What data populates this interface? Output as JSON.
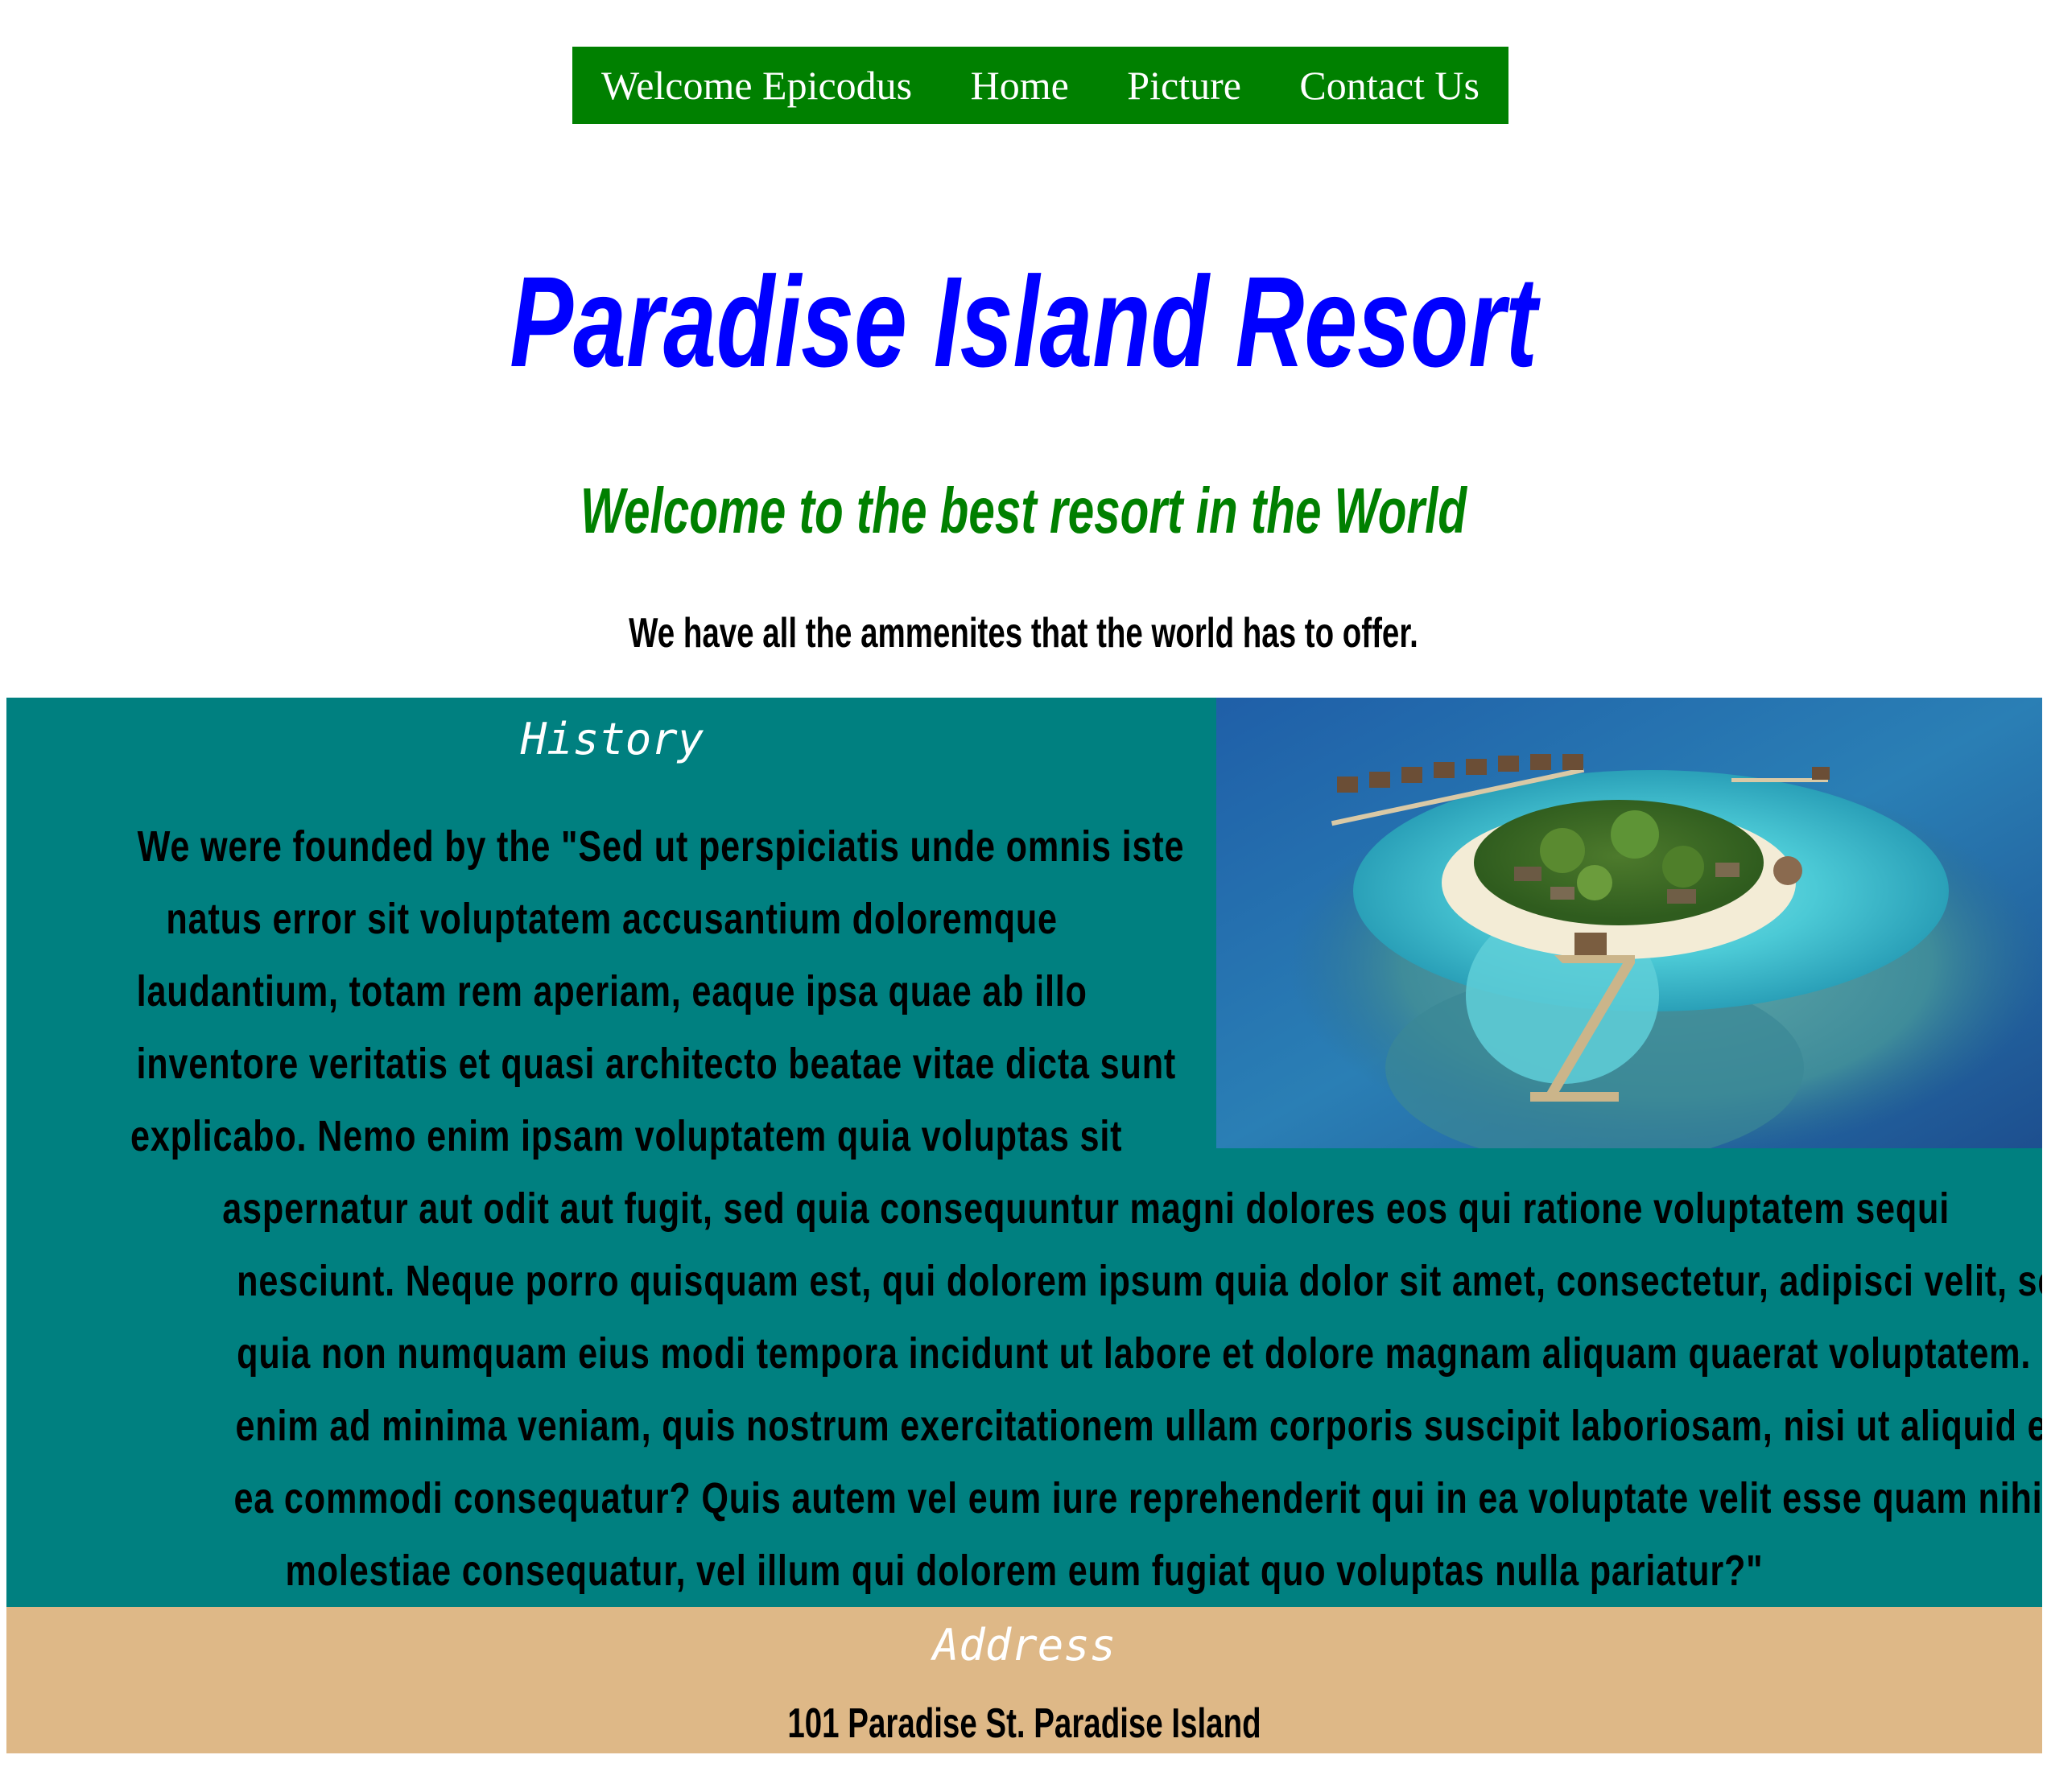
{
  "nav": {
    "items": [
      "Welcome Epicodus",
      "Home",
      "Picture",
      "Contact Us"
    ]
  },
  "header": {
    "title": "Paradise Island Resort",
    "subtitle": "Welcome to the best resort in the World",
    "tagline": "We have all the ammenites that the world has to offer."
  },
  "history": {
    "heading": "History",
    "lines": [
      "We were founded by the \"Sed ut perspiciatis unde omnis iste",
      "natus error sit voluptatem accusantium doloremque",
      "laudantium, totam rem aperiam, eaque ipsa quae ab illo",
      "inventore veritatis et quasi architecto beatae vitae dicta sunt",
      "explicabo. Nemo enim ipsam voluptatem quia voluptas sit",
      "aspernatur aut odit aut fugit, sed quia consequuntur magni dolores eos qui ratione voluptatem sequi",
      "nesciunt. Neque porro quisquam est, qui dolorem ipsum quia dolor sit amet, consectetur, adipisci velit, sed",
      "quia non numquam eius modi tempora incidunt ut labore et dolore magnam aliquam quaerat voluptatem. Ut",
      "enim ad minima veniam, quis nostrum exercitationem ullam corporis suscipit laboriosam, nisi ut aliquid ex",
      "ea commodi consequatur? Quis autem vel eum iure reprehenderit qui in ea voluptate velit esse quam nihil",
      "molestiae consequatur, vel illum qui dolorem eum fugiat quo voluptas nulla pariatur?\""
    ]
  },
  "address": {
    "heading": "Address",
    "text": "101 Paradise St. Paradise Island"
  },
  "colors": {
    "nav_bg": "#008000",
    "title": "#0000ff",
    "subtitle": "#008000",
    "history_bg": "#008080",
    "address_bg": "#deb887",
    "section_heading": "#ffffff"
  }
}
